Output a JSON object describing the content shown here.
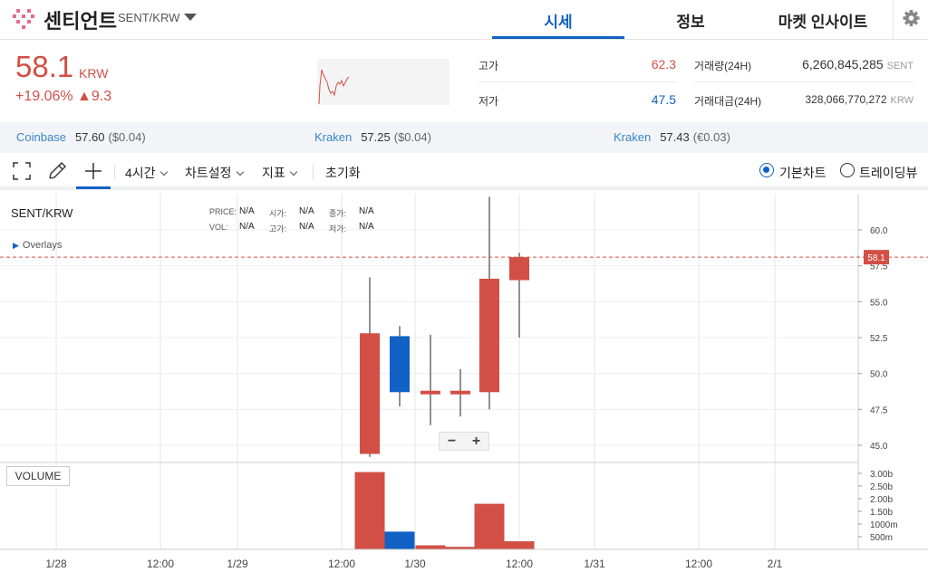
{
  "header": {
    "coin_name": "센티언트",
    "pair": "SENT/KRW",
    "tabs": [
      {
        "label": "시세",
        "active": true
      },
      {
        "label": "정보",
        "active": false
      },
      {
        "label": "마켓 인사이트",
        "active": false
      }
    ],
    "accent_color": "#1261c4"
  },
  "ticker": {
    "price": "58.1",
    "unit": "KRW",
    "change": "+19.06% ▲9.3",
    "high_label": "고가",
    "high_value": "62.3",
    "low_label": "저가",
    "low_value": "47.5",
    "volume_label": "거래량(24H)",
    "volume_value": "6,260,845,285",
    "volume_unit": "SENT",
    "amount_label": "거래대금(24H)",
    "amount_value": "328,066,770,272",
    "amount_unit": "KRW",
    "up_color": "#d24f45",
    "down_color": "#1261c4"
  },
  "exchanges": [
    {
      "name": "Coinbase",
      "price": "57.60",
      "diff": "($0.04)"
    },
    {
      "name": "Kraken",
      "price": "57.25",
      "diff": "($0.04)"
    },
    {
      "name": "Kraken",
      "price": "57.43",
      "diff": "(€0.03)"
    }
  ],
  "toolbar": {
    "interval": "4시간",
    "chart_settings": "차트설정",
    "indicators": "지표",
    "reset": "초기화",
    "basic_chart": "기본차트",
    "tradingview": "트레이딩뷰",
    "selected_view": "basic"
  },
  "chart": {
    "symbol": "SENT/KRW",
    "overlays_label": "Overlays",
    "info": {
      "price_label": "PRICE:",
      "price_value": "N/A",
      "open_label": "시가:",
      "open_value": "N/A",
      "close_label": "종가:",
      "close_value": "N/A",
      "vol_label": "VOL:",
      "vol_value": "N/A",
      "high_label": "고가:",
      "high_value": "N/A",
      "low_label": "저가:",
      "low_value": "N/A"
    },
    "zoom_out": "−",
    "zoom_in": "+",
    "volume_label": "VOLUME"
  },
  "chart_data": {
    "type": "candlestick",
    "price_axis": {
      "ticks": [
        "60.0",
        "57.5",
        "55.0",
        "52.5",
        "50.0",
        "47.5",
        "45.0"
      ],
      "range": [
        44.0,
        62.5
      ]
    },
    "current_price": "58.1",
    "volume_axis": {
      "ticks": [
        "3.00b",
        "2.50b",
        "2.00b",
        "1.50b",
        "1000m",
        "500m"
      ],
      "range": [
        0,
        3.2
      ]
    },
    "time_axis": [
      "1/28",
      "12:00",
      "1/29",
      "12:00",
      "1/30",
      "12:00",
      "1/31",
      "12:00",
      "2/1"
    ],
    "candles": [
      {
        "open": 44.4,
        "close": 52.8,
        "high": 56.7,
        "low": 44.2,
        "volume": 3.05,
        "dir": "up"
      },
      {
        "open": 52.6,
        "close": 48.7,
        "high": 53.3,
        "low": 47.7,
        "volume": 0.7,
        "dir": "down"
      },
      {
        "open": 48.6,
        "close": 48.8,
        "high": 52.7,
        "low": 46.4,
        "volume": 0.16,
        "dir": "up"
      },
      {
        "open": 48.7,
        "close": 48.8,
        "high": 50.3,
        "low": 47.0,
        "volume": 0.1,
        "dir": "up"
      },
      {
        "open": 48.7,
        "close": 56.6,
        "high": 62.3,
        "low": 47.5,
        "volume": 1.8,
        "dir": "up"
      },
      {
        "open": 56.5,
        "close": 58.1,
        "high": 58.4,
        "low": 52.5,
        "volume": 0.32,
        "dir": "up"
      }
    ]
  }
}
